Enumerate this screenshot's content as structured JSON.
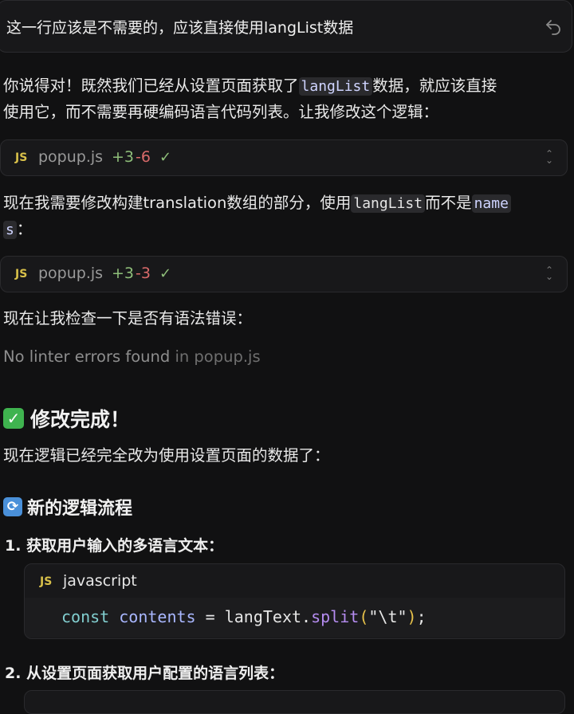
{
  "user_message": {
    "text": "这一行应该是不需要的，应该直接使用langList数据"
  },
  "p1": {
    "before": "你说得对！既然我们已经从设置页面获取了",
    "code": "langList",
    "after1": "数据，就应该直接",
    "line2": "使用它，而不需要再硬编码语言代码列表。让我修改这个逻辑："
  },
  "chip1": {
    "badge": "JS",
    "file": "popup.js",
    "added": "+3",
    "removed": "-6",
    "check": "✓"
  },
  "p2": {
    "before": "现在我需要修改构建translation数组的部分，使用",
    "code1": "langList",
    "mid": "而不是",
    "code2a": "name",
    "code2b": "s",
    "end": "："
  },
  "chip2": {
    "badge": "JS",
    "file": "popup.js",
    "added": "+3",
    "removed": "-3",
    "check": "✓"
  },
  "p3": {
    "text": "现在让我检查一下是否有语法错误："
  },
  "lint": {
    "text": "No linter errors found",
    "in": "in popup.js"
  },
  "section1": {
    "emoji": "✓",
    "title": "修改完成！"
  },
  "p4": {
    "text": "现在逻辑已经完全改为使用设置页面的数据了："
  },
  "section2": {
    "emoji": "⟳",
    "title": "新的逻辑流程"
  },
  "list": [
    {
      "num": "1.",
      "text": "获取用户输入的多语言文本："
    },
    {
      "num": "2.",
      "text": "从设置页面获取用户配置的语言列表："
    }
  ],
  "codeblock": {
    "badge": "JS",
    "lang": "javascript",
    "tokens": {
      "kw": "const",
      "var": "contents",
      "eq": " = ",
      "obj": "langText.",
      "fn": "split",
      "lp": "(",
      "str": "\"\\t\"",
      "rp": ")",
      "semi": ";"
    }
  }
}
